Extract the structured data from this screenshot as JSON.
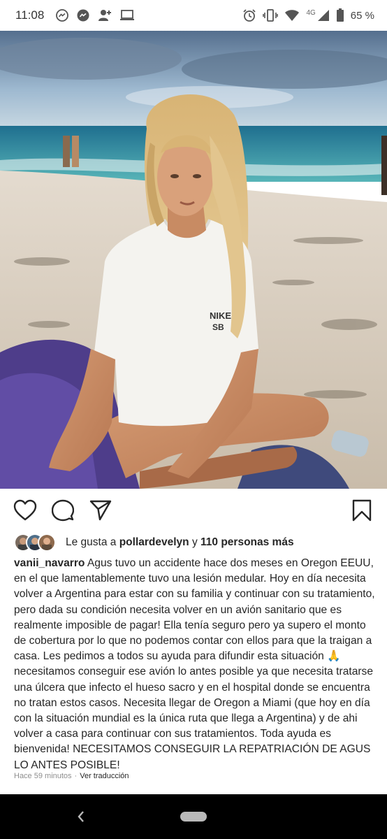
{
  "status_bar": {
    "time": "11:08",
    "network": "4G",
    "battery": "65 %",
    "icons": [
      "messenger-icon",
      "messenger-icon",
      "add-person-icon",
      "laptop-icon",
      "alarm-icon",
      "vibrate-icon",
      "wifi-icon",
      "signal-icon",
      "battery-icon"
    ]
  },
  "post": {
    "liked_by_prefix": "Le gusta a ",
    "liked_by_user": "pollardevelyn",
    "liked_by_joiner": " y ",
    "liked_by_others": "110 personas más",
    "caption_user": "vanii_navarro",
    "caption_text": " Agus tuvo un accidente hace dos meses en Oregon EEUU, en el que lamentablemente tuvo una lesión medular. Hoy en día necesita volver a Argentina para estar con su familia y continuar con su tratamiento, pero dada su condición necesita volver en un avión sanitario que es realmente imposible de pagar! Ella tenía seguro pero ya supero el monto de cobertura por lo que no podemos contar con ellos para que la traigan a casa. Les pedimos a todos su ayuda para difundir esta situación 🙏 necesitamos conseguir ese avión lo antes posible ya que necesita tratarse una úlcera que infecto el hueso sacro y en el hospital donde se encuentra no tratan estos casos. Necesita llegar de Oregon a Miami (que hoy en día con la situación mundial es la única ruta que llega a Argentina) y de ahi volver a casa para continuar con sus tratamientos. Toda ayuda es bienvenida! NECESITAMOS CONSEGUIR LA REPATRIACIÓN DE AGUS LO ANTES POSIBLE!",
    "time_ago": "Hace 59 minutos",
    "separator": "·",
    "translate_link": "Ver traducción"
  },
  "photo": {
    "shirt_text_1": "NIKE",
    "shirt_text_2": "SB"
  },
  "colors": {
    "text": "#262626",
    "muted": "#8e8e8e",
    "sky": "#7fa3c4",
    "sea": "#2c8ea0",
    "sand": "#d9cfc0",
    "navbar": "#000000"
  }
}
